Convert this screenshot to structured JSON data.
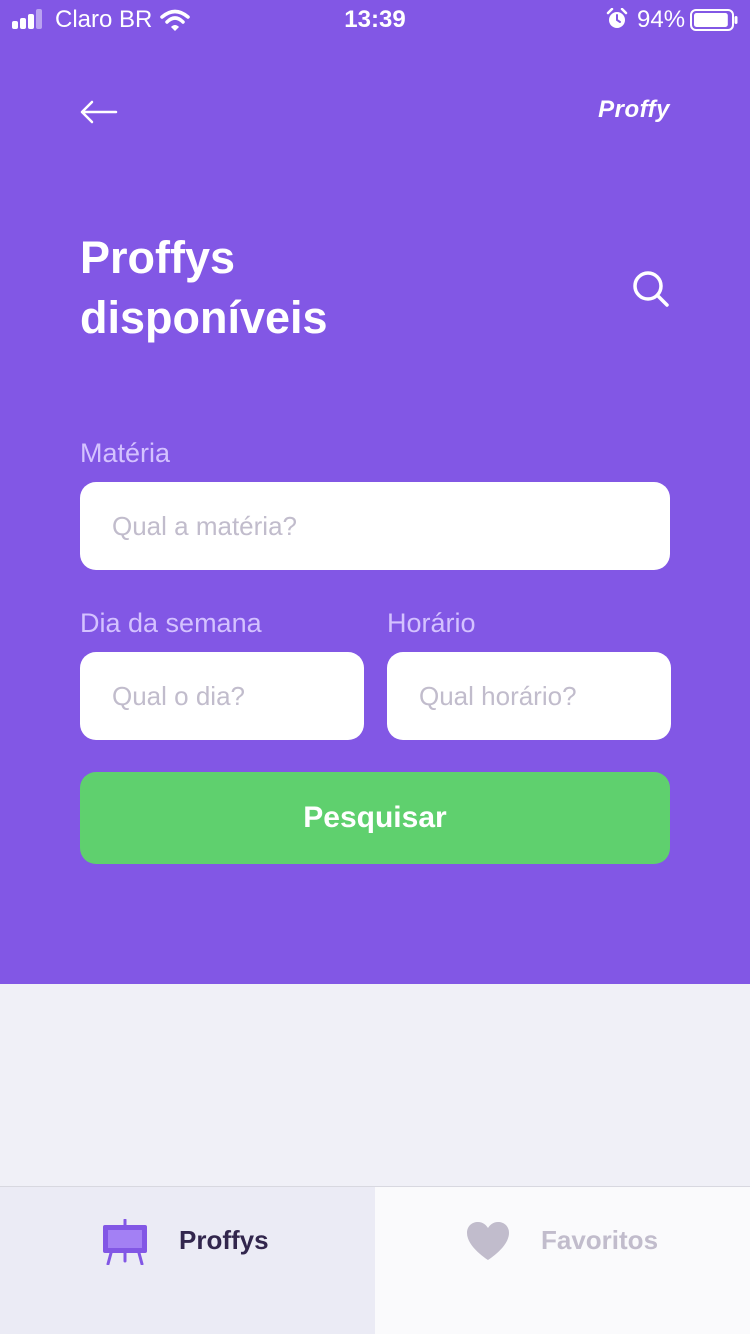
{
  "status_bar": {
    "carrier": "Claro BR",
    "time": "13:39",
    "battery": "94%",
    "battery_level": 0.94,
    "signal_bars": 3,
    "icons": [
      "signal-icon",
      "wifi-icon",
      "alarm-icon",
      "battery-icon"
    ]
  },
  "nav": {
    "back_icon": "arrow-left-icon",
    "logo": "Proffy"
  },
  "page": {
    "title_line1": "Proffys",
    "title_line2": "disponíveis",
    "search_icon": "search-icon"
  },
  "filters": {
    "subject": {
      "label": "Matéria",
      "placeholder": "Qual a matéria?",
      "value": ""
    },
    "weekday": {
      "label": "Dia da semana",
      "placeholder": "Qual o dia?",
      "value": ""
    },
    "time": {
      "label": "Horário",
      "placeholder": "Qual horário?",
      "value": ""
    },
    "submit_label": "Pesquisar"
  },
  "tabs": [
    {
      "label": "Proffys",
      "icon": "easel-icon",
      "active": true
    },
    {
      "label": "Favoritos",
      "icon": "heart-icon",
      "active": false
    }
  ],
  "colors": {
    "primary": "#8257E5",
    "secondary": "#5FD06E",
    "background": "#F0F0F7",
    "label": "#D4C2FF",
    "placeholder": "#C1BCCC",
    "title_text": "#32264D"
  }
}
